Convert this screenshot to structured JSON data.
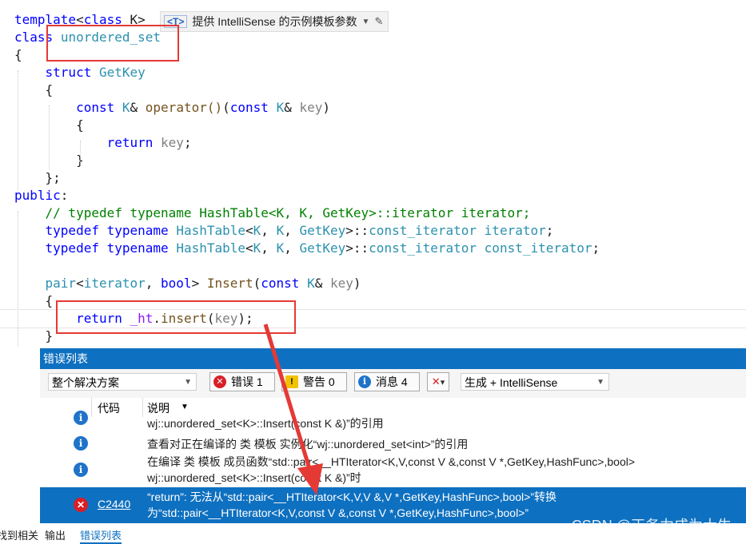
{
  "code_lines": [
    {
      "parts": [
        [
          "kw",
          "template"
        ],
        [
          "",
          "<"
        ],
        [
          "kw",
          "class"
        ],
        [
          "",
          " K>"
        ]
      ]
    },
    {
      "parts": [
        [
          "kw",
          "class"
        ],
        [
          "",
          " "
        ],
        [
          "ty",
          "unordered_set"
        ]
      ]
    },
    {
      "parts": [
        [
          "",
          "{"
        ]
      ]
    },
    {
      "parts": [
        [
          "",
          "    "
        ],
        [
          "kw",
          "struct"
        ],
        [
          "",
          " "
        ],
        [
          "ty",
          "GetKey"
        ]
      ]
    },
    {
      "parts": [
        [
          "",
          "    {"
        ]
      ]
    },
    {
      "parts": [
        [
          "",
          "        "
        ],
        [
          "kw",
          "const"
        ],
        [
          "",
          " "
        ],
        [
          "ty",
          "K"
        ],
        [
          "",
          "& "
        ],
        [
          "fn",
          "operator()"
        ],
        [
          "",
          "("
        ],
        [
          "kw",
          "const"
        ],
        [
          "",
          " "
        ],
        [
          "ty",
          "K"
        ],
        [
          "",
          "& "
        ],
        [
          "pm",
          "key"
        ],
        [
          "",
          ")"
        ]
      ]
    },
    {
      "parts": [
        [
          "",
          "        {"
        ]
      ]
    },
    {
      "parts": [
        [
          "",
          "            "
        ],
        [
          "kw",
          "return"
        ],
        [
          "",
          " "
        ],
        [
          "pm",
          "key"
        ],
        [
          "",
          ";"
        ]
      ]
    },
    {
      "parts": [
        [
          "",
          "        }"
        ]
      ]
    },
    {
      "parts": [
        [
          "",
          "    };"
        ]
      ]
    },
    {
      "parts": [
        [
          "kw",
          "public"
        ],
        [
          "",
          ":"
        ]
      ]
    },
    {
      "parts": [
        [
          "",
          "    "
        ],
        [
          "cm",
          "// typedef typename HashTable<K, K, GetKey>::iterator iterator;"
        ]
      ]
    },
    {
      "parts": [
        [
          "",
          "    "
        ],
        [
          "kw",
          "typedef"
        ],
        [
          "",
          " "
        ],
        [
          "kw",
          "typename"
        ],
        [
          "",
          " "
        ],
        [
          "ty",
          "HashTable"
        ],
        [
          "",
          "<"
        ],
        [
          "ty",
          "K"
        ],
        [
          "",
          ", "
        ],
        [
          "ty",
          "K"
        ],
        [
          "",
          ", "
        ],
        [
          "ty",
          "GetKey"
        ],
        [
          "",
          ">::"
        ],
        [
          "ty",
          "const_iterator"
        ],
        [
          "",
          " "
        ],
        [
          "ty",
          "iterator"
        ],
        [
          "",
          ";"
        ]
      ]
    },
    {
      "parts": [
        [
          "",
          "    "
        ],
        [
          "kw",
          "typedef"
        ],
        [
          "",
          " "
        ],
        [
          "kw",
          "typename"
        ],
        [
          "",
          " "
        ],
        [
          "ty",
          "HashTable"
        ],
        [
          "",
          "<"
        ],
        [
          "ty",
          "K"
        ],
        [
          "",
          ", "
        ],
        [
          "ty",
          "K"
        ],
        [
          "",
          ", "
        ],
        [
          "ty",
          "GetKey"
        ],
        [
          "",
          ">::"
        ],
        [
          "ty",
          "const_iterator"
        ],
        [
          "",
          " "
        ],
        [
          "ty",
          "const_iterator"
        ],
        [
          "",
          ";"
        ]
      ]
    },
    {
      "parts": [
        [
          "",
          ""
        ]
      ]
    },
    {
      "parts": [
        [
          "",
          "    "
        ],
        [
          "ty",
          "pair"
        ],
        [
          "",
          "<"
        ],
        [
          "ty",
          "iterator"
        ],
        [
          "",
          ", "
        ],
        [
          "kw",
          "bool"
        ],
        [
          "",
          "> "
        ],
        [
          "fn",
          "Insert"
        ],
        [
          "",
          "("
        ],
        [
          "kw",
          "const"
        ],
        [
          "",
          " "
        ],
        [
          "ty",
          "K"
        ],
        [
          "",
          "& "
        ],
        [
          "pm",
          "key"
        ],
        [
          "",
          ")"
        ]
      ]
    },
    {
      "parts": [
        [
          "",
          "    {"
        ]
      ]
    },
    {
      "parts": [
        [
          "",
          "        "
        ],
        [
          "kw",
          "return"
        ],
        [
          "",
          " "
        ],
        [
          "mb",
          "_ht"
        ],
        [
          "",
          "."
        ],
        [
          "fn",
          "insert"
        ],
        [
          "",
          "("
        ],
        [
          "pm",
          "key"
        ],
        [
          "",
          ");"
        ]
      ]
    },
    {
      "parts": [
        [
          "",
          "    }"
        ]
      ]
    }
  ],
  "hint": {
    "tag": "<T>",
    "text": "提供 IntelliSense 的示例模板参数"
  },
  "panel": {
    "title": "错误列表",
    "scope": "整个解决方案",
    "errors_label": "错误 1",
    "warnings_label": "警告 0",
    "messages_label": "消息 4",
    "build_filter": "生成 + IntelliSense",
    "col_code": "代码",
    "col_desc": "说明"
  },
  "rows": [
    {
      "type": "info",
      "code": "",
      "lines": [
        "wj::unordered_set<K>::Insert(const K &)”的引用"
      ]
    },
    {
      "type": "info",
      "code": "",
      "lines": [
        "查看对正在编译的 类 模板 实例化“wj::unordered_set<int>”的引用"
      ]
    },
    {
      "type": "info",
      "code": "",
      "lines": [
        "在编译 类 模板 成员函数“std::pair<__HTIterator<K,V,const V &,const V *,GetKey,HashFunc>,bool>",
        "wj::unordered_set<K>::Insert(const K &)”时"
      ]
    },
    {
      "type": "error",
      "code": "C2440",
      "lines": [
        "“return”: 无法从“std::pair<__HTIterator<K,V,V &,V *,GetKey,HashFunc>,bool>”转换",
        "为“std::pair<__HTIterator<K,V,const V &,const V *,GetKey,HashFunc>,bool>”"
      ]
    }
  ],
  "bottom_tabs": [
    "找到相关",
    "输出",
    "错误列表"
  ],
  "watermark": "CSDN @正务力成为大牛",
  "colors": {
    "accent": "#0e70c0",
    "error": "#d91f26",
    "info": "#1f73c9",
    "highlight_box": "#e53935"
  }
}
